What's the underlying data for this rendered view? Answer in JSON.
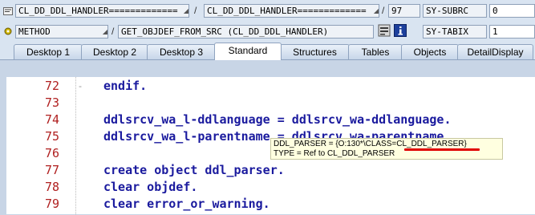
{
  "header": {
    "row1": {
      "program_field": "CL_DD_DDL_HANDLER=============",
      "separator1": "/",
      "include_field": "CL_DD_DDL_HANDLER=============",
      "separator2": "/",
      "line_number": "97",
      "sysvar_name": "SY-SUBRC",
      "sysvar_value": "0"
    },
    "row2": {
      "type_field": "METHOD",
      "separator1": "/",
      "method_field": "GET_OBJDEF_FROM_SRC (CL_DD_DDL_HANDLER)",
      "sysvar_name": "SY-TABIX",
      "sysvar_value": "1"
    }
  },
  "tabs": [
    {
      "label": "Desktop 1",
      "active": false
    },
    {
      "label": "Desktop 2",
      "active": false
    },
    {
      "label": "Desktop 3",
      "active": false
    },
    {
      "label": "Standard",
      "active": true
    },
    {
      "label": "Structures",
      "active": false
    },
    {
      "label": "Tables",
      "active": false
    },
    {
      "label": "Objects",
      "active": false
    },
    {
      "label": "DetailDisplay",
      "active": false
    }
  ],
  "code_lines": [
    {
      "number": "72",
      "text": "endif."
    },
    {
      "number": "73",
      "text": ""
    },
    {
      "number": "74",
      "text": "ddlsrcv_wa_l-ddlanguage = ddlsrcv_wa-ddlanguage."
    },
    {
      "number": "75",
      "text": "ddlsrcv_wa_l-parentname = ddlsrcv_wa-parentname."
    },
    {
      "number": "76",
      "text": ""
    },
    {
      "number": "77",
      "text": "create object ddl_parser."
    },
    {
      "number": "78",
      "text": "clear objdef."
    },
    {
      "number": "79",
      "text": "clear error_or_warning."
    }
  ],
  "tooltip": {
    "line1": "DDL_PARSER = {O:130*\\CLASS=CL_DDL_PARSER}",
    "line2": "TYPE  = Ref to CL_DDL_PARSER"
  },
  "colors": {
    "keyword": "#1a1a9e",
    "line_number": "#b02020",
    "highlight_underline": "#e00000"
  }
}
